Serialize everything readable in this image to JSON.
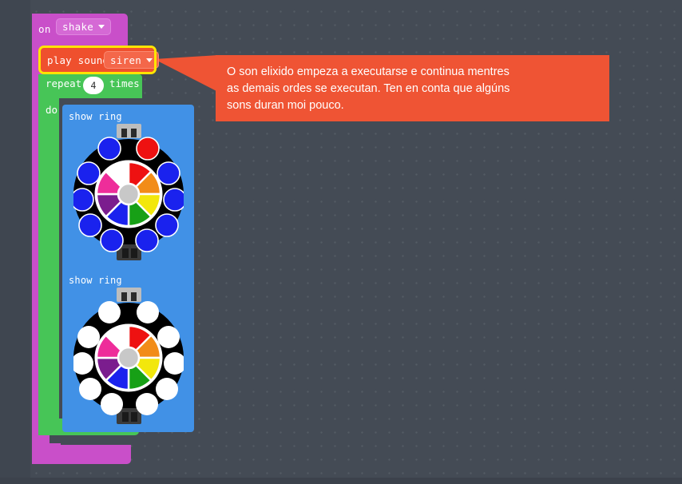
{
  "editor": {
    "background_color": "#444b55",
    "grid_dot_color": "#5a616c"
  },
  "blocks": [
    {
      "id": "on-shake",
      "type": "hat",
      "color": "#c94fc9",
      "label": "on",
      "dropdown_value": "shake"
    },
    {
      "id": "play-sound",
      "type": "statement",
      "color": "#ef502e",
      "highlight_color": "#ffe400",
      "highlighted": true,
      "label": "play sound",
      "dropdown_value": "siren"
    },
    {
      "id": "repeat",
      "type": "c-block",
      "color": "#47c557",
      "label_before": "repeat",
      "value": "4",
      "label_after": "times",
      "inner_label": "do"
    },
    {
      "id": "show-ring-1",
      "type": "statement",
      "color": "#4191e6",
      "label": "show ring"
    },
    {
      "id": "show-ring-2",
      "type": "statement",
      "color": "#4191e6",
      "label": "show ring"
    }
  ],
  "rings": [
    {
      "id": "ring-1",
      "outer_leds": [
        "#1a22ee",
        "#ee1111",
        "#1a22ee",
        "#1a22ee",
        "#1a22ee",
        "#1a22ee",
        "#1a22ee",
        "#1a22ee",
        "#1a22ee",
        "#1a22ee",
        "#1a22ee",
        "#1a22ee"
      ],
      "wheel_segments": [
        "#ee1111",
        "#f28c18",
        "#f2e70c",
        "#17a016",
        "#1a22ee",
        "#7b1d8e",
        "#ee2d9a",
        "#ffffff"
      ],
      "hub_color": "#c8c8c8",
      "body_color": "#000000"
    },
    {
      "id": "ring-2",
      "outer_leds": [
        "#ffffff",
        "#ffffff",
        "#ffffff",
        "#ffffff",
        "#ffffff",
        "#ffffff",
        "#ffffff",
        "#ffffff",
        "#ffffff",
        "#ffffff",
        "#ffffff",
        "#ffffff"
      ],
      "wheel_segments": [
        "#ee1111",
        "#f28c18",
        "#f2e70c",
        "#17a016",
        "#1a22ee",
        "#7b1d8e",
        "#ee2d9a",
        "#ffffff"
      ],
      "hub_color": "#c8c8c8",
      "body_color": "#000000"
    }
  ],
  "tooltip": {
    "background_color": "#ef5434",
    "text_line_1": "O son elixido empeza a executarse e continua mentres",
    "text_line_2": "as demais ordes se executan. Ten en conta que algúns",
    "text_line_3": "sons duran moi pouco."
  }
}
